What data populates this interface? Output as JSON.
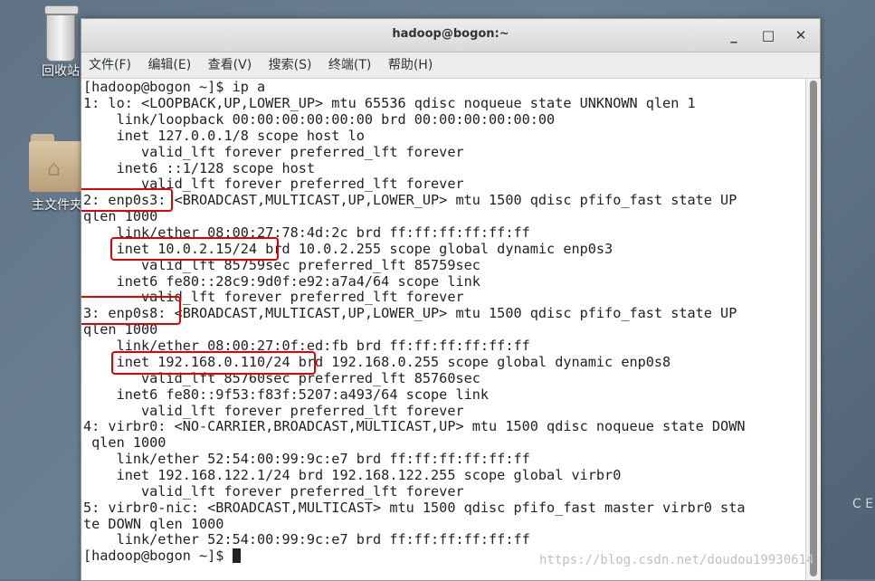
{
  "desktop": {
    "trash_label": "回收站",
    "home_label": "主文件夹",
    "edge_text": "C E"
  },
  "window": {
    "title": "hadoop@bogon:~",
    "buttons": {
      "minimize": "_",
      "maximize": "□",
      "close": "✕"
    }
  },
  "menu": [
    "文件(F)",
    "编辑(E)",
    "查看(V)",
    "搜索(S)",
    "终端(T)",
    "帮助(H)"
  ],
  "terminal": {
    "lines": [
      "[hadoop@bogon ~]$ ip a",
      "1: lo: <LOOPBACK,UP,LOWER_UP> mtu 65536 qdisc noqueue state UNKNOWN qlen 1",
      "    link/loopback 00:00:00:00:00:00 brd 00:00:00:00:00:00",
      "    inet 127.0.0.1/8 scope host lo",
      "       valid_lft forever preferred_lft forever",
      "    inet6 ::1/128 scope host",
      "       valid_lft forever preferred_lft forever",
      "2: enp0s3: <BROADCAST,MULTICAST,UP,LOWER_UP> mtu 1500 qdisc pfifo_fast state UP",
      "qlen 1000",
      "    link/ether 08:00:27:78:4d:2c brd ff:ff:ff:ff:ff:ff",
      "    inet 10.0.2.15/24 brd 10.0.2.255 scope global dynamic enp0s3",
      "       valid_lft 85759sec preferred_lft 85759sec",
      "    inet6 fe80::28c9:9d0f:e92:a7a4/64 scope link",
      "       valid_lft forever preferred_lft forever",
      "3: enp0s8: <BROADCAST,MULTICAST,UP,LOWER_UP> mtu 1500 qdisc pfifo_fast state UP",
      "qlen 1000",
      "    link/ether 08:00:27:0f:ed:fb brd ff:ff:ff:ff:ff:ff",
      "    inet 192.168.0.110/24 brd 192.168.0.255 scope global dynamic enp0s8",
      "       valid_lft 85760sec preferred_lft 85760sec",
      "    inet6 fe80::9f53:f83f:5207:a493/64 scope link",
      "       valid_lft forever preferred_lft forever",
      "4: virbr0: <NO-CARRIER,BROADCAST,MULTICAST,UP> mtu 1500 qdisc noqueue state DOWN",
      " qlen 1000",
      "    link/ether 52:54:00:99:9c:e7 brd ff:ff:ff:ff:ff:ff",
      "    inet 192.168.122.1/24 brd 192.168.122.255 scope global virbr0",
      "       valid_lft forever preferred_lft forever",
      "5: virbr0-nic: <BROADCAST,MULTICAST> mtu 1500 qdisc pfifo_fast master virbr0 sta",
      "te DOWN qlen 1000",
      "    link/ether 52:54:00:99:9c:e7 brd ff:ff:ff:ff:ff:ff",
      "[hadoop@bogon ~]$ "
    ]
  },
  "watermark": "https://blog.csdn.net/doudou19930614",
  "colors": {
    "highlight": "#e00000",
    "terminal_bg": "#ffffff",
    "terminal_fg": "#222222"
  }
}
